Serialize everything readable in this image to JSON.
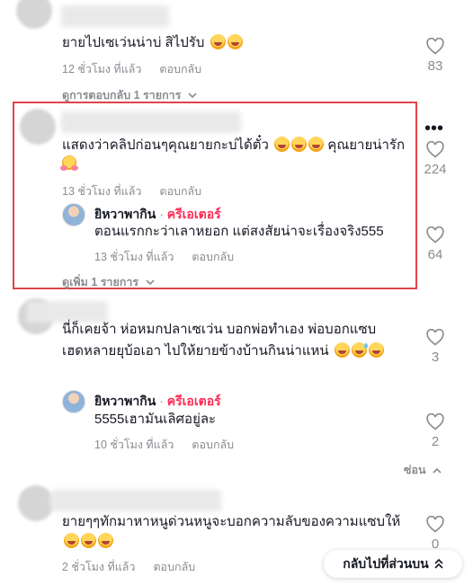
{
  "comments": [
    {
      "text": "ยายไปเซเว่นน่าบ่ สิไปรับ",
      "time": "12 ชั่วโมง ที่แล้ว",
      "reply_label": "ตอบกลับ",
      "likes": "83",
      "view_replies": "ดูการตอบกลับ 1 รายการ"
    },
    {
      "text": "แสดงว่าคลิปก่อนๆคุณยายกะบ่ได้ตั๋ว",
      "text_tail": "คุณยายน่ารัก",
      "time": "13 ชั่วโมง ที่แล้ว",
      "reply_label": "ตอบกลับ",
      "likes": "224",
      "reply": {
        "name": "ยิหวาพากิน",
        "dot": "·",
        "badge": "ครีเอเตอร์",
        "text": "ตอนแรกกะว่าเลาหยอก แต่สงสัยน่าจะเรื่องจริง555",
        "time": "13 ชั่วโมง ที่แล้ว",
        "reply_label": "ตอบกลับ",
        "likes": "64"
      },
      "view_more": "ดูเพิ่ม 1 รายการ"
    },
    {
      "text_line1": "นี่ก็เคยจ้า ห่อหมกปลาเซเว่น บอกพ่อทำเอง พ่อบอกแซบ",
      "text_line2": "เฮดหลายยุบ้อเอา ไปให้ยายข้างบ้านกินน่าแหน่",
      "likes": "3",
      "reply": {
        "name": "ยิหวาพากิน",
        "dot": "·",
        "badge": "ครีเอเตอร์",
        "text": "5555เฮามันเลิศอยู่ละ",
        "time": "10 ชั่วโมง ที่แล้ว",
        "reply_label": "ตอบกลับ",
        "likes": "2"
      },
      "hide": "ซ่อน"
    },
    {
      "text": "ยายๆๆทักมาหาหนูด่วนหนูจะบอกความลับของความแซบให้",
      "time": "2 ชั่วโมง ที่แล้ว",
      "reply_label": "ตอบกลับ",
      "likes": "0"
    }
  ],
  "back_to_top": "กลับไปที่ส่วนบน",
  "icons": [
    "heart-icon",
    "chevron-down-icon",
    "chevron-up-icon",
    "more-icon",
    "double-chevron-up-icon"
  ],
  "colors": {
    "creator": "#fe2c55",
    "meta": "#8a8b91",
    "highlight": "#e0434b"
  }
}
